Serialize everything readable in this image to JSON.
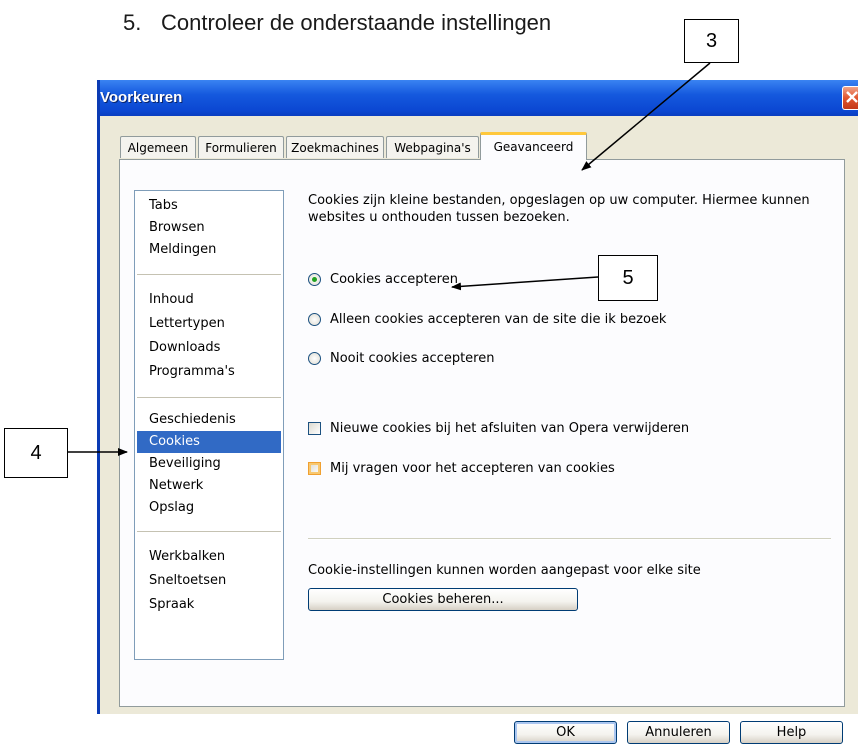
{
  "instruction": {
    "number": "5.",
    "text": "Controleer de onderstaande instellingen"
  },
  "window": {
    "title": "Voorkeuren"
  },
  "tabs": [
    {
      "label": "Algemeen",
      "active": false
    },
    {
      "label": "Formulieren",
      "active": false
    },
    {
      "label": "Zoekmachines",
      "active": false
    },
    {
      "label": "Webpagina's",
      "active": false
    },
    {
      "label": "Geavanceerd",
      "active": true
    }
  ],
  "sidebar": {
    "groups": [
      [
        "Tabs",
        "Browsen",
        "Meldingen"
      ],
      [
        "Inhoud",
        "Lettertypen",
        "Downloads",
        "Programma's"
      ],
      [
        "Geschiedenis",
        "Cookies",
        "Beveiliging",
        "Netwerk",
        "Opslag"
      ],
      [
        "Werkbalken",
        "Sneltoetsen",
        "Spraak"
      ]
    ],
    "selected": "Cookies"
  },
  "cookies": {
    "intro": "Cookies zijn kleine bestanden, opgeslagen op uw computer. Hiermee kunnen websites u onthouden tussen bezoeken.",
    "radio_options": [
      {
        "label": "Cookies accepteren",
        "checked": true
      },
      {
        "label": "Alleen cookies accepteren van de site die ik bezoek",
        "checked": false
      },
      {
        "label": "Nooit cookies accepteren",
        "checked": false
      }
    ],
    "checkboxes": [
      {
        "label": "Nieuwe cookies bij het afsluiten van Opera verwijderen",
        "checked": false
      },
      {
        "label": "Mij vragen voor het accepteren van cookies",
        "checked": false
      }
    ],
    "manage_text": "Cookie-instellingen kunnen worden aangepast voor elke site",
    "manage_button": "Cookies beheren..."
  },
  "dialog_buttons": {
    "ok": "OK",
    "cancel": "Annuleren",
    "help": "Help"
  },
  "annotations": {
    "tab_callout": "3",
    "list_callout": "4",
    "option_callout": "5"
  },
  "colors": {
    "titlebar": "#0b47d2",
    "dialog_bg": "#ece9d8",
    "selection": "#316ac5",
    "active_tab_accent": "#ffc83c"
  },
  "icons": {
    "close": "close-icon"
  }
}
